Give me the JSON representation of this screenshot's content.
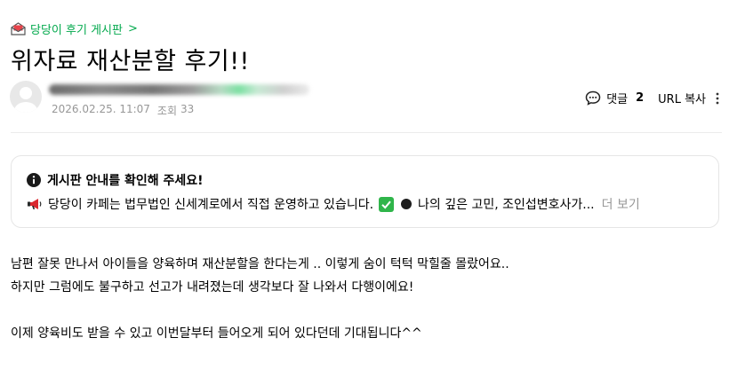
{
  "breadcrumb": {
    "label": "당당이 후기 게시판",
    "chevron": ">"
  },
  "post": {
    "title": "위자료 재산분할 후기!!",
    "date": "2026.02.25. 11:07",
    "views_label": "조회",
    "views": "33"
  },
  "actions": {
    "comment_label": "댓글",
    "comment_count": "2",
    "url_copy_label": "URL 복사"
  },
  "notice": {
    "heading": "게시판 안내를 확인해 주세요!",
    "text_part1": "당당이 카페는 법무법인 신세계로에서 직접 운영하고 있습니다.",
    "text_part2": "나의 깊은 고민, 조인섭변호사가...",
    "more_label": "더 보기"
  },
  "content": {
    "lines": [
      "남편 잘못 만나서 아이들을 양육하며 재산분할을 한다는게 .. 이렇게 숨이 턱턱 막힐줄 몰랐어요..",
      "하지만 그럼에도 불구하고 선고가 내려졌는데 생각보다 잘 나와서 다행이에요!",
      "",
      "이제 양육비도 받을 수 있고 이번달부터 들어오게 되어 있다던데 기대됩니다^^"
    ]
  },
  "colors": {
    "accent": "#03a94d",
    "meta": "#979797",
    "check": "#2fb54a"
  },
  "icons": [
    "board-icon",
    "avatar-icon",
    "comment-icon",
    "more-vertical-icon",
    "info-icon",
    "megaphone-icon",
    "checkmark-icon",
    "black-circle-icon"
  ]
}
